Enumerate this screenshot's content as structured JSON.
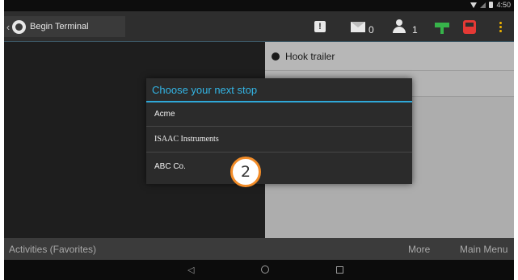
{
  "statusbar": {
    "time": "4:50",
    "icons": [
      "wifi-icon",
      "signal-icon",
      "battery-icon"
    ]
  },
  "topbar": {
    "back_label": "Begin Terminal",
    "mail_count": "0",
    "user_count": "1",
    "alert_glyph": "!",
    "colors": {
      "trailer": "#37b34a",
      "truck": "#e53935",
      "menu": "#f0b400"
    }
  },
  "activity": {
    "label": "Hook trailer"
  },
  "dialog": {
    "title": "Choose your next stop",
    "options": [
      "Acme",
      "ISAAC Instruments",
      "ABC Co."
    ],
    "accent": "#33b5e5"
  },
  "callout": {
    "number": "2",
    "color": "#f28c28"
  },
  "actionbar": {
    "activities": "Activities (Favorites)",
    "more": "More",
    "main_menu": "Main Menu"
  }
}
